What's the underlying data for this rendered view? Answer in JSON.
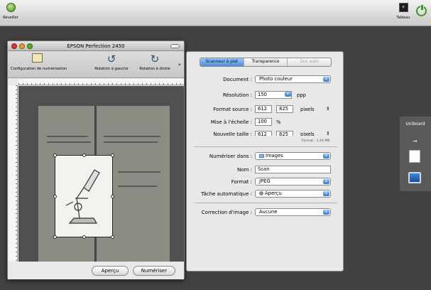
{
  "topbar": {
    "reveal_label": "Réveiller",
    "tableau_label": "Tableau"
  },
  "scan_window": {
    "title": "EPSON Perfection 2450",
    "tools": {
      "config": "Configuration de numérisation",
      "rotate_left": "Rotation à gauche",
      "rotate_right": "Rotation à droite",
      "more": "»"
    },
    "preview_button": "Aperçu",
    "scan_button": "Numériser"
  },
  "settings": {
    "tabs": [
      "Scanneur à plat",
      "Transparence",
      "Doc auto"
    ],
    "document_label": "Document :",
    "document_value": "Photo couleur",
    "resolution_label": "Résolution :",
    "resolution_value": "150",
    "resolution_unit": "ppp",
    "source_label": "Format source :",
    "source_w": "612",
    "source_h": "825",
    "source_unit": "pixels",
    "scale_label": "Mise à l'échelle :",
    "scale_value": "100",
    "scale_unit": "%",
    "new_size_label": "Nouvelle taille :",
    "new_w": "612",
    "new_h": "825",
    "new_unit": "pixels",
    "format_size": "Format : 1.44 MB",
    "scan_to_label": "Numériser dans :",
    "scan_to_value": "Images",
    "name_label": "Nom :",
    "name_value": "Scan",
    "format_label": "Format :",
    "format_value": "JPEG",
    "task_label": "Tâche automatique :",
    "task_value": "Aperçu",
    "correction_label": "Correction d'image :",
    "correction_value": "Aucune"
  },
  "dock": {
    "title": "Uniboard"
  },
  "colors": {
    "desktop": "#424242",
    "accent_blue": "#4d8fd9",
    "power_green": "#3b9a21"
  }
}
